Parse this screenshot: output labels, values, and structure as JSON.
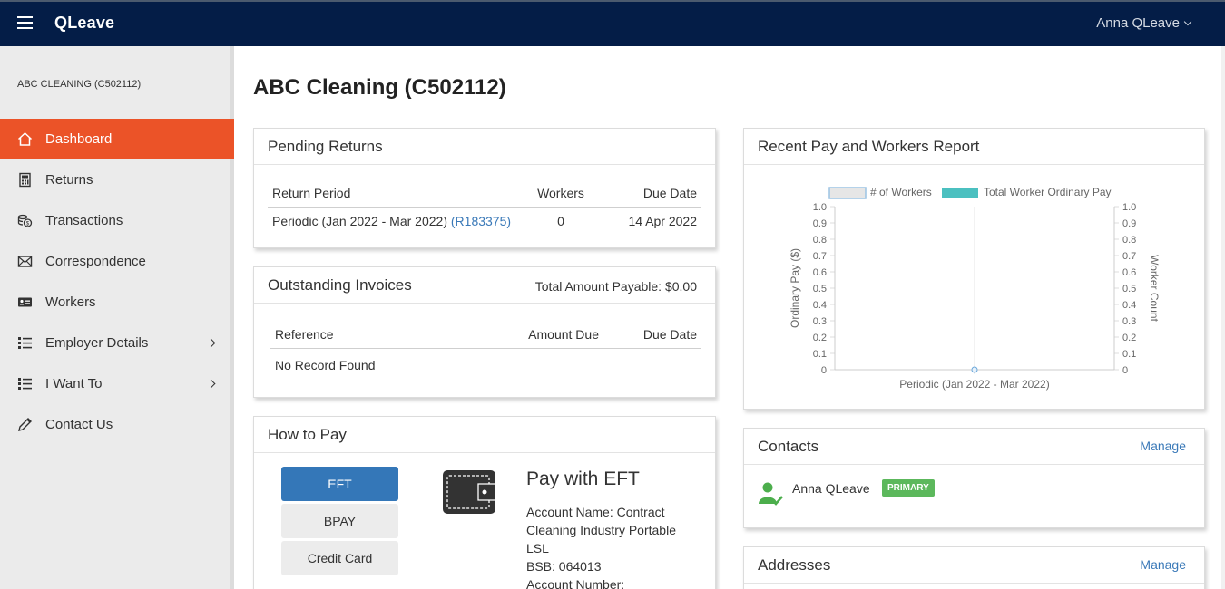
{
  "topbar": {
    "brand": "QLeave",
    "user": "Anna QLeave"
  },
  "sidebar": {
    "org": "ABC CLEANING (C502112)",
    "items": [
      {
        "label": "Dashboard",
        "icon": "home-icon",
        "active": true
      },
      {
        "label": "Returns",
        "icon": "calculator-icon"
      },
      {
        "label": "Transactions",
        "icon": "coins-icon"
      },
      {
        "label": "Correspondence",
        "icon": "envelope-icon"
      },
      {
        "label": "Workers",
        "icon": "id-card-icon"
      },
      {
        "label": "Employer Details",
        "icon": "list-icon",
        "submenu": true
      },
      {
        "label": "I Want To",
        "icon": "list-icon",
        "submenu": true
      },
      {
        "label": "Contact Us",
        "icon": "pencil-icon"
      }
    ]
  },
  "page": {
    "title": "ABC Cleaning (C502112)"
  },
  "pending": {
    "title": "Pending Returns",
    "headers": [
      "Return Period",
      "Workers",
      "Due Date"
    ],
    "row": {
      "period": "Periodic (Jan 2022 - Mar 2022)",
      "ref": "(R183375)",
      "workers": "0",
      "due": "14 Apr 2022"
    }
  },
  "invoices": {
    "title": "Outstanding Invoices",
    "total": "Total Amount Payable: $0.00",
    "headers": [
      "Reference",
      "Amount Due",
      "Due Date"
    ],
    "empty": "No Record Found"
  },
  "howto": {
    "title": "How to Pay",
    "tabs": [
      "EFT",
      "BPAY",
      "Credit Card"
    ],
    "heading": "Pay with EFT",
    "lines": [
      "Account Name: Contract Cleaning Industry Portable LSL",
      "BSB: 064013",
      "Account Number:"
    ]
  },
  "report": {
    "title": "Recent Pay and Workers Report"
  },
  "chart_data": {
    "type": "bar",
    "categories": [
      "Periodic (Jan 2022 - Mar 2022)"
    ],
    "series": [
      {
        "name": "# of Workers",
        "type": "bar",
        "values": [
          0
        ],
        "color": "#e6e6e6",
        "axis": "right"
      },
      {
        "name": "Total Worker Ordinary Pay",
        "type": "line",
        "values": [
          0
        ],
        "color": "#4bc0c0",
        "axis": "left"
      }
    ],
    "ylabel": "Ordinary Pay ($)",
    "y2label": "Worker Count",
    "ylim": [
      0,
      1.0
    ],
    "y2lim": [
      0,
      1.0
    ],
    "yticks": [
      "1.0",
      "0.9",
      "0.8",
      "0.7",
      "0.6",
      "0.5",
      "0.4",
      "0.3",
      "0.2",
      "0.1",
      "0"
    ],
    "grid": true,
    "legend": "top"
  },
  "contacts": {
    "title": "Contacts",
    "manage": "Manage",
    "name": "Anna QLeave",
    "badge": "PRIMARY"
  },
  "addresses": {
    "title": "Addresses",
    "manage": "Manage"
  }
}
